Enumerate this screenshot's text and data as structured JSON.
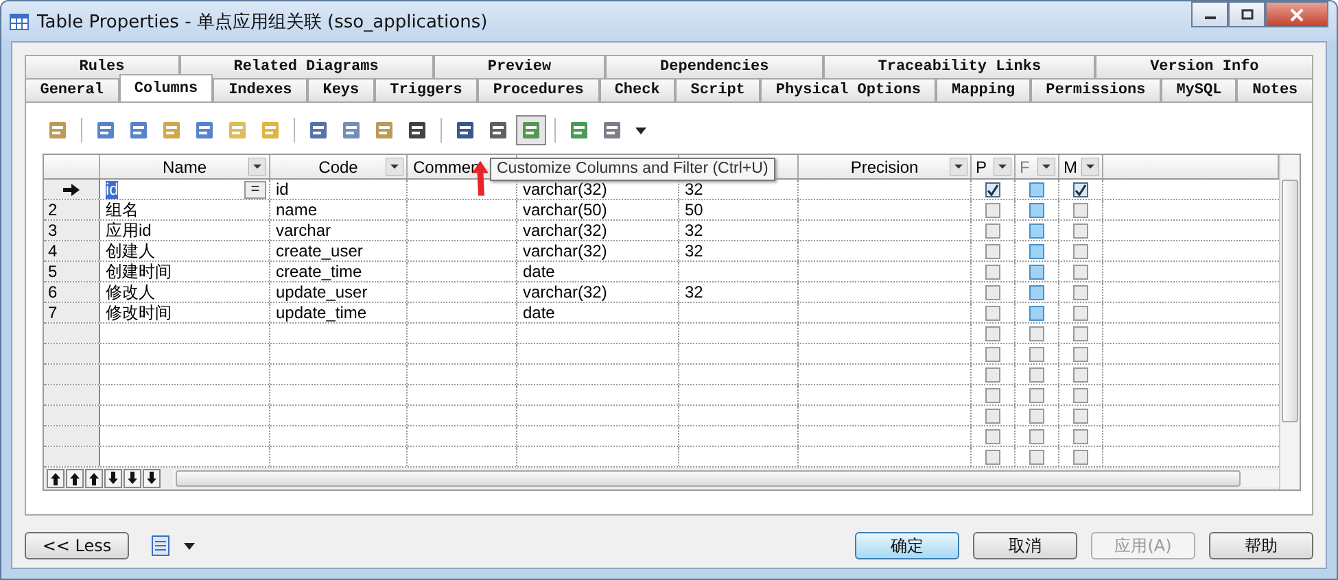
{
  "window": {
    "title": "Table Properties - 单点应用组关联 (sso_applications)"
  },
  "tabs_top": [
    {
      "label": "Rules",
      "selected": false
    },
    {
      "label": "Related Diagrams",
      "selected": false
    },
    {
      "label": "Preview",
      "selected": false
    },
    {
      "label": "Dependencies",
      "selected": false
    },
    {
      "label": "Traceability Links",
      "selected": false
    },
    {
      "label": "Version Info",
      "selected": false
    }
  ],
  "tabs": [
    {
      "label": "General",
      "selected": false
    },
    {
      "label": "Columns",
      "selected": true
    },
    {
      "label": "Indexes",
      "selected": false
    },
    {
      "label": "Keys",
      "selected": false
    },
    {
      "label": "Triggers",
      "selected": false
    },
    {
      "label": "Procedures",
      "selected": false
    },
    {
      "label": "Check",
      "selected": false
    },
    {
      "label": "Script",
      "selected": false
    },
    {
      "label": "Physical Options",
      "selected": false
    },
    {
      "label": "Mapping",
      "selected": false
    },
    {
      "label": "Permissions",
      "selected": false
    },
    {
      "label": "MySQL",
      "selected": false
    },
    {
      "label": "Notes",
      "selected": false
    }
  ],
  "tooltip": "Customize Columns and Filter (Ctrl+U)",
  "table": {
    "columns": [
      {
        "label": "Name",
        "dropdown": true
      },
      {
        "label": "Code",
        "dropdown": true
      },
      {
        "label": "Commen",
        "dropdown": false
      },
      {
        "label": "Precision",
        "dropdown": true
      }
    ],
    "flag_columns": [
      {
        "label": "P",
        "highlighted": false
      },
      {
        "label": "F",
        "highlighted": true
      },
      {
        "label": "M",
        "highlighted": false
      }
    ],
    "rows": [
      {
        "current": true,
        "editing": true,
        "edit_button": "=",
        "cells": [
          "id",
          "id",
          null,
          "varchar(32)",
          "32",
          null
        ],
        "flags": [
          true,
          false,
          true
        ]
      },
      {
        "current": false,
        "number": "2",
        "cells": [
          "组名",
          "name",
          null,
          "varchar(50)",
          "50",
          null
        ],
        "flags": [
          false,
          false,
          false
        ]
      },
      {
        "current": false,
        "number": "3",
        "cells": [
          "应用id",
          "varchar",
          null,
          "varchar(32)",
          "32",
          null
        ],
        "flags": [
          false,
          false,
          false
        ]
      },
      {
        "current": false,
        "number": "4",
        "cells": [
          "创建人",
          "create_user",
          null,
          "varchar(32)",
          "32",
          null
        ],
        "flags": [
          false,
          false,
          false
        ]
      },
      {
        "current": false,
        "number": "5",
        "cells": [
          "创建时间",
          "create_time",
          null,
          "date",
          null,
          null
        ],
        "flags": [
          false,
          false,
          false
        ]
      },
      {
        "current": false,
        "number": "6",
        "cells": [
          "修改人",
          "update_user",
          null,
          "varchar(32)",
          "32",
          null
        ],
        "flags": [
          false,
          false,
          false
        ]
      },
      {
        "current": false,
        "number": "7",
        "cells": [
          "修改时间",
          "update_time",
          null,
          "date",
          null,
          null
        ],
        "flags": [
          false,
          false,
          false
        ]
      }
    ],
    "empty_rows": [
      {
        "flags": [
          false,
          false,
          false
        ]
      },
      {
        "flags": [
          false,
          false,
          false
        ]
      },
      {
        "flags": [
          false,
          false,
          false
        ]
      },
      {
        "flags": [
          false,
          false,
          false
        ]
      },
      {
        "flags": [
          false,
          false,
          false
        ]
      },
      {
        "flags": [
          false,
          false,
          false
        ]
      },
      {
        "flags": [
          false,
          false,
          false
        ]
      }
    ]
  },
  "buttons": {
    "less": "<< Less",
    "ok": "确定",
    "cancel": "取消",
    "apply": {
      "label": "应用(A)",
      "disabled": true
    },
    "help": "帮助"
  }
}
